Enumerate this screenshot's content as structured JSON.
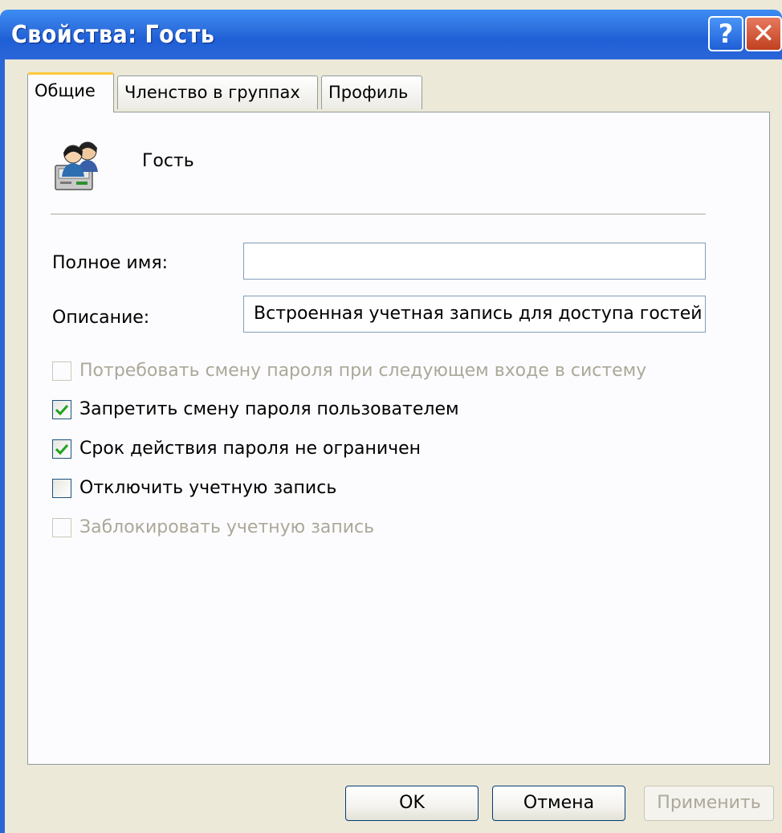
{
  "window": {
    "title": "Свойства: Гость",
    "help_glyph": "?",
    "close_glyph": "✕"
  },
  "tabs": [
    {
      "label": "Общие",
      "active": true
    },
    {
      "label": "Членство в группах",
      "active": false
    },
    {
      "label": "Профиль",
      "active": false
    }
  ],
  "general": {
    "user_icon": "users-icon",
    "user_name": "Гость",
    "full_name_label": "Полное имя:",
    "full_name_value": "",
    "description_label": "Описание:",
    "description_value": "Встроенная учетная запись для доступа гостей"
  },
  "checkboxes": [
    {
      "label": "Потребовать смену пароля при следующем входе в систему",
      "checked": false,
      "enabled": false
    },
    {
      "label": "Запретить смену пароля пользователем",
      "checked": true,
      "enabled": true
    },
    {
      "label": "Срок действия пароля не ограничен",
      "checked": true,
      "enabled": true
    },
    {
      "label": "Отключить учетную запись",
      "checked": false,
      "enabled": true
    },
    {
      "label": "Заблокировать учетную запись",
      "checked": false,
      "enabled": false
    }
  ],
  "buttons": {
    "ok": "OK",
    "cancel": "Отмена",
    "apply": "Применить"
  },
  "colors": {
    "titlebar": "#2a66d8",
    "checkmark": "#21a121",
    "disabled_text": "#aca899"
  }
}
